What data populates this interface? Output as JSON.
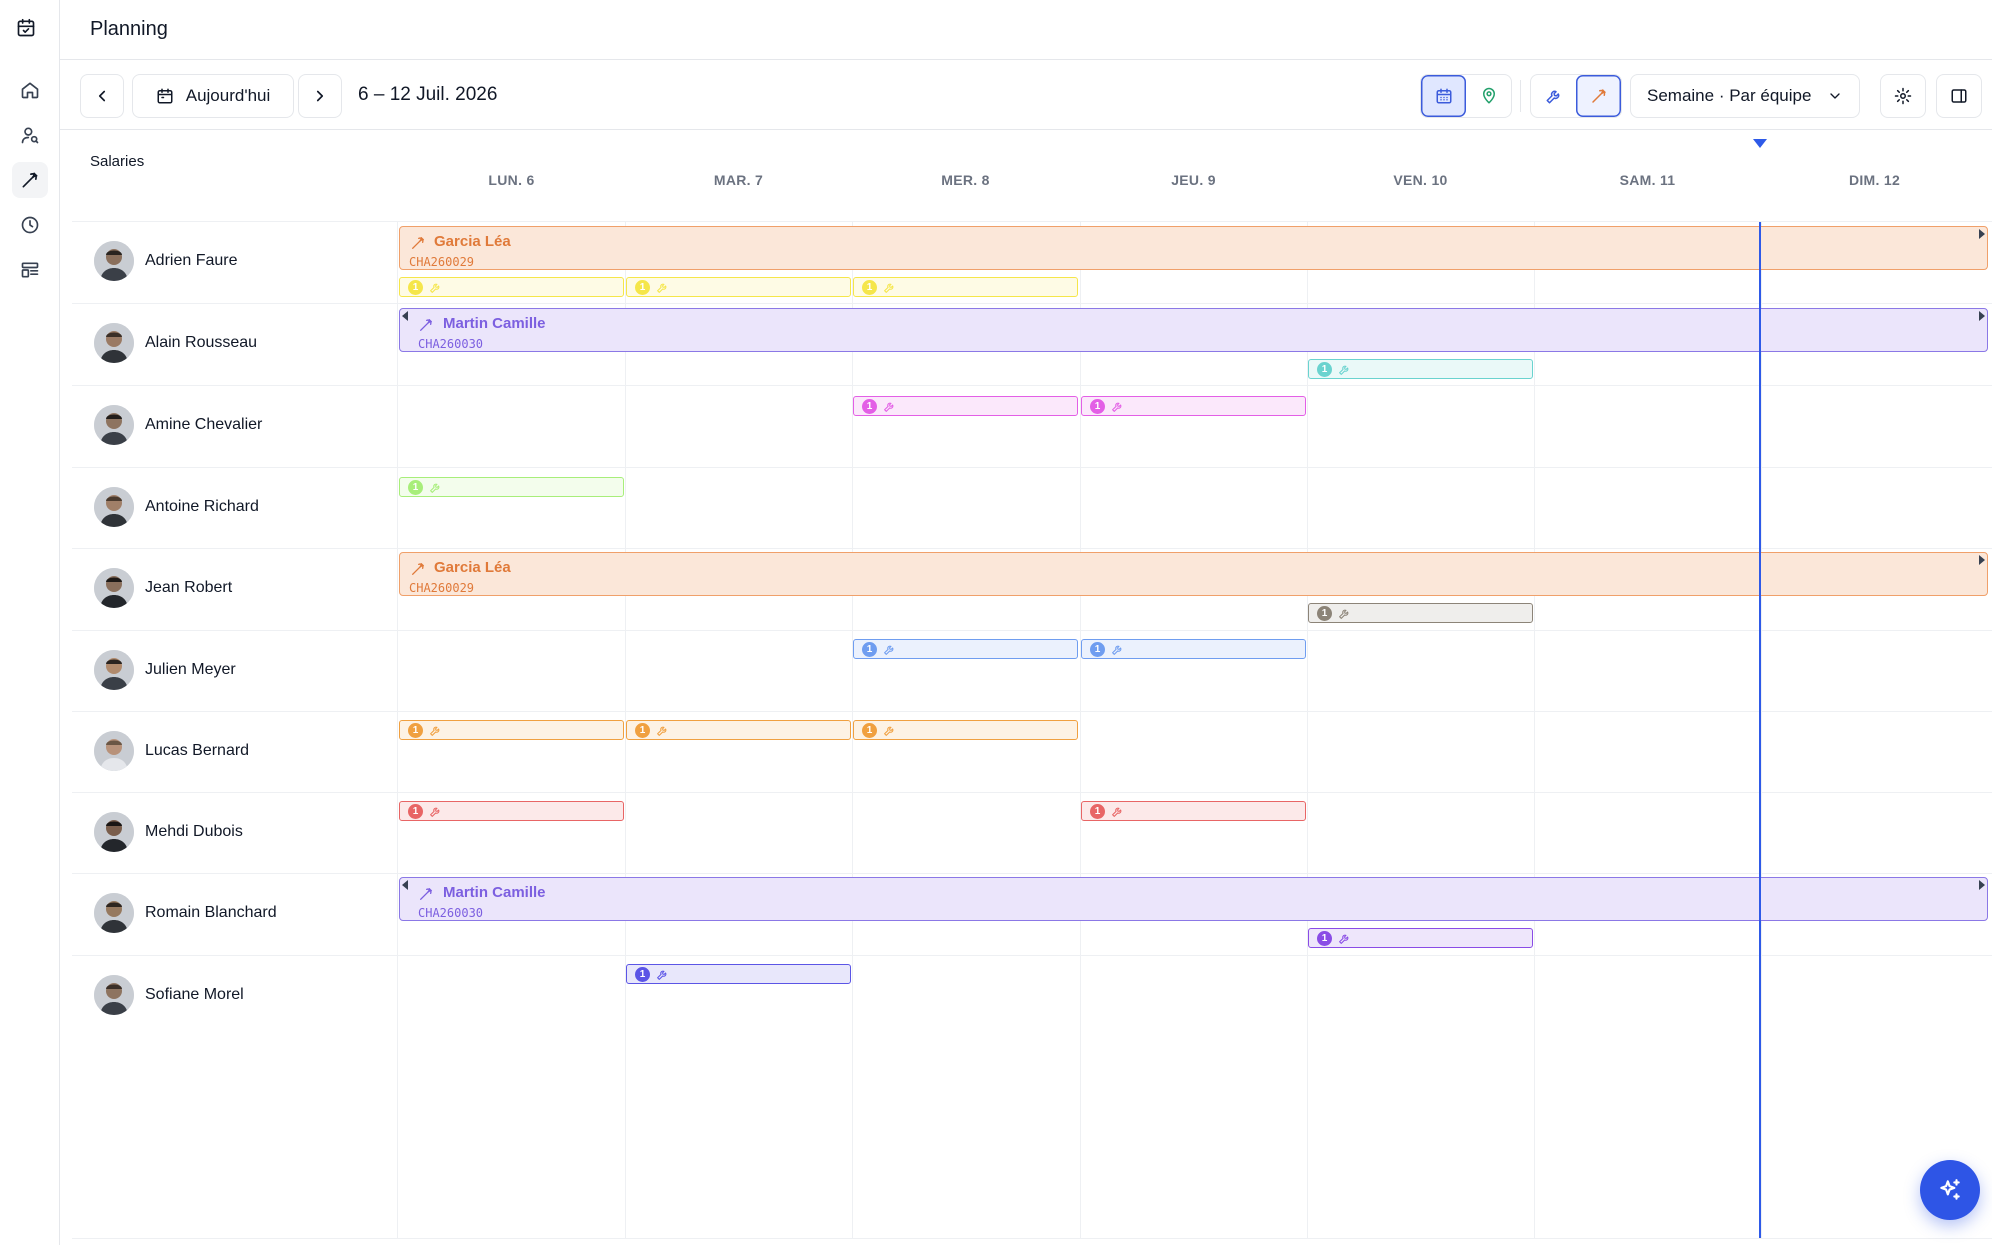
{
  "header": {
    "title": "Planning"
  },
  "toolbar": {
    "today_label": "Aujourd'hui",
    "date_range": "6 – 12 Juil. 2026",
    "view_select": "Semaine · Par équipe"
  },
  "grid": {
    "column_title": "Salaries",
    "days": [
      "LUN. 6",
      "MAR. 7",
      "MER. 8",
      "JEU. 9",
      "VEN. 10",
      "SAM. 11",
      "DIM. 12"
    ],
    "employees": [
      "Adrien Faure",
      "Alain Rousseau",
      "Amine Chevalier",
      "Antoine Richard",
      "Jean Robert",
      "Julien Meyer",
      "Lucas Bernard",
      "Mehdi Dubois",
      "Romain Blanchard",
      "Sofiane Morel"
    ]
  },
  "chantiers": [
    {
      "client": "Garcia Léa",
      "code": "CHA260029",
      "color": "#e07a3a"
    },
    {
      "client": "Martin Camille",
      "code": "CHA260030",
      "color": "#7c5fe0"
    },
    {
      "client": "Garcia Léa",
      "code": "CHA260029",
      "color": "#e07a3a"
    },
    {
      "client": "Martin Camille",
      "code": "CHA260030",
      "color": "#7c5fe0"
    }
  ],
  "task_count": "1",
  "colors": {
    "accent": "#2e5ae8",
    "yellow": "#f5e64a",
    "teal": "#6ad3cf",
    "magenta": "#e35fe6",
    "lime": "#a8ee7a",
    "gray": "#8c8478",
    "blue": "#6f9df0",
    "amber": "#f0a040",
    "red": "#e86565",
    "violet": "#8a4ce6",
    "indigo": "#5b55e6"
  }
}
